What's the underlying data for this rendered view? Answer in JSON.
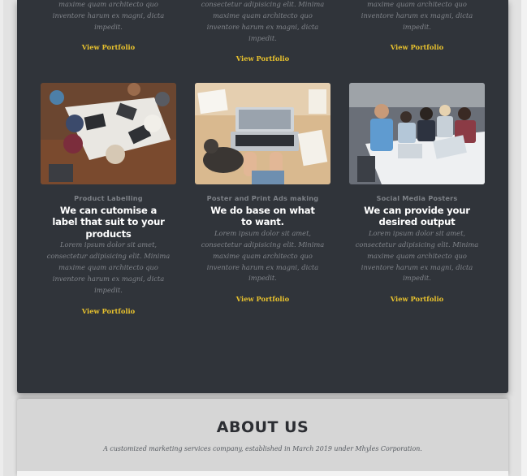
{
  "portfolio": {
    "top_row": [
      {
        "description_lines": [
          "maxime quam architecto quo",
          "inventore harum ex magni, dicta",
          "impedit."
        ],
        "link": "View Portfolio"
      },
      {
        "description_lines": [
          "consectetur adipisicing elit. Minima",
          "maxime quam architecto quo",
          "inventore harum ex magni, dicta",
          "impedit."
        ],
        "link": "View Portfolio"
      },
      {
        "description_lines": [
          "maxime quam architecto quo",
          "inventore harum ex magni, dicta",
          "impedit."
        ],
        "link": "View Portfolio"
      }
    ],
    "cards": [
      {
        "image": "team-meeting-photo",
        "category": "Product Labelling",
        "heading_lines": [
          "We can cutomise a",
          "label that suit to your",
          "products"
        ],
        "description_lines": [
          "Lorem ipsum dolor sit amet,",
          "consectetur adipisicing elit. Minima",
          "maxime quam architecto quo",
          "inventore harum ex magni, dicta",
          "impedit."
        ],
        "link": "View Portfolio"
      },
      {
        "image": "laptop-desk-cat-photo",
        "category": "Poster and Print Ads making",
        "heading_lines": [
          "We do base on what",
          "to want."
        ],
        "description_lines": [
          "Lorem ipsum dolor sit amet,",
          "consectetur adipisicing elit. Minima",
          "maxime quam architecto quo",
          "inventore harum ex magni, dicta",
          "impedit."
        ],
        "link": "View Portfolio"
      },
      {
        "image": "group-laptops-photo",
        "category": "Social Media Posters",
        "heading_lines": [
          "We can provide your",
          "desired output"
        ],
        "description_lines": [
          "Lorem ipsum dolor sit amet,",
          "consectetur adipisicing elit. Minima",
          "maxime quam architecto quo",
          "inventore harum ex magni, dicta",
          "impedit."
        ],
        "link": "View Portfolio"
      }
    ]
  },
  "about": {
    "title": "ABOUT US",
    "subtitle": "A customized marketing services company, established in March 2019 under Mhyles Corporation."
  },
  "colors": {
    "panel": "#30343a",
    "accent": "#e8c22e",
    "about_bg": "#d6d6d6"
  }
}
